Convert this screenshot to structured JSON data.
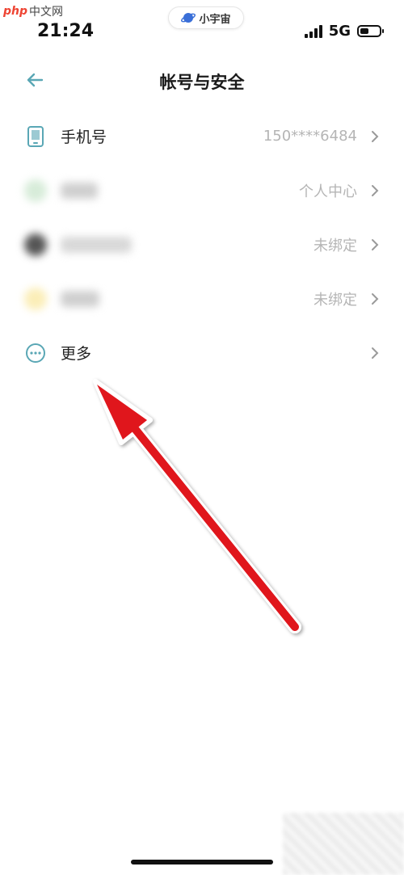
{
  "watermark": {
    "php": "php",
    "site": "中文网"
  },
  "island": {
    "label": "小宇宙"
  },
  "status": {
    "time": "21:24",
    "network": "5G"
  },
  "nav": {
    "title": "帐号与安全"
  },
  "rows": [
    {
      "label": "手机号",
      "value": "150****6484",
      "icon": "phone-icon",
      "blurred": false
    },
    {
      "label": "",
      "value": "个人中心",
      "icon": "blurred-app-icon",
      "blurred": true
    },
    {
      "label": "",
      "value": "未绑定",
      "icon": "blurred-app-icon",
      "blurred": true
    },
    {
      "label": "",
      "value": "未绑定",
      "icon": "blurred-app-icon",
      "blurred": true
    },
    {
      "label": "更多",
      "value": "",
      "icon": "more-icon",
      "blurred": false
    }
  ],
  "colors": {
    "accent": "#5aa7b5",
    "annotation_arrow": "#e0121b"
  }
}
